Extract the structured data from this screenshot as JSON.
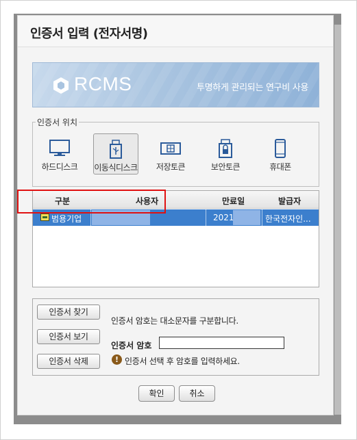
{
  "dialog": {
    "title": "인증서 입력 (전자서명)"
  },
  "banner": {
    "logo_text": "RCMS",
    "slogan": "투명하게 관리되는 연구비 사용"
  },
  "location": {
    "legend": "인증서 위치",
    "items": [
      {
        "label": "하드디스크",
        "icon": "monitor-icon",
        "selected": false
      },
      {
        "label": "이동식디스크",
        "icon": "usb-icon",
        "selected": true
      },
      {
        "label": "저장토큰",
        "icon": "token-card-icon",
        "selected": false
      },
      {
        "label": "보안토큰",
        "icon": "secure-token-icon",
        "selected": false
      },
      {
        "label": "휴대폰",
        "icon": "phone-icon",
        "selected": false
      }
    ]
  },
  "cert_table": {
    "headers": [
      "구분",
      "사용자",
      "만료일",
      "발급자"
    ],
    "rows": [
      {
        "type": "범용기업",
        "user": "",
        "expiry": "2021-",
        "issuer": "한국전자인..."
      }
    ]
  },
  "actions": {
    "find": "인증서 찾기",
    "view": "인증서 보기",
    "delete": "인증서 삭제"
  },
  "password": {
    "info": "인증서 암호는 대소문자를 구분합니다.",
    "label": "인증서 암호",
    "value": "",
    "hint": "인증서 선택 후 암호를 입력하세요."
  },
  "footer": {
    "ok": "확인",
    "cancel": "취소"
  },
  "colors": {
    "selection": "#3c7fcd",
    "highlight_border": "#e01010",
    "banner": "#a9c4e0"
  }
}
